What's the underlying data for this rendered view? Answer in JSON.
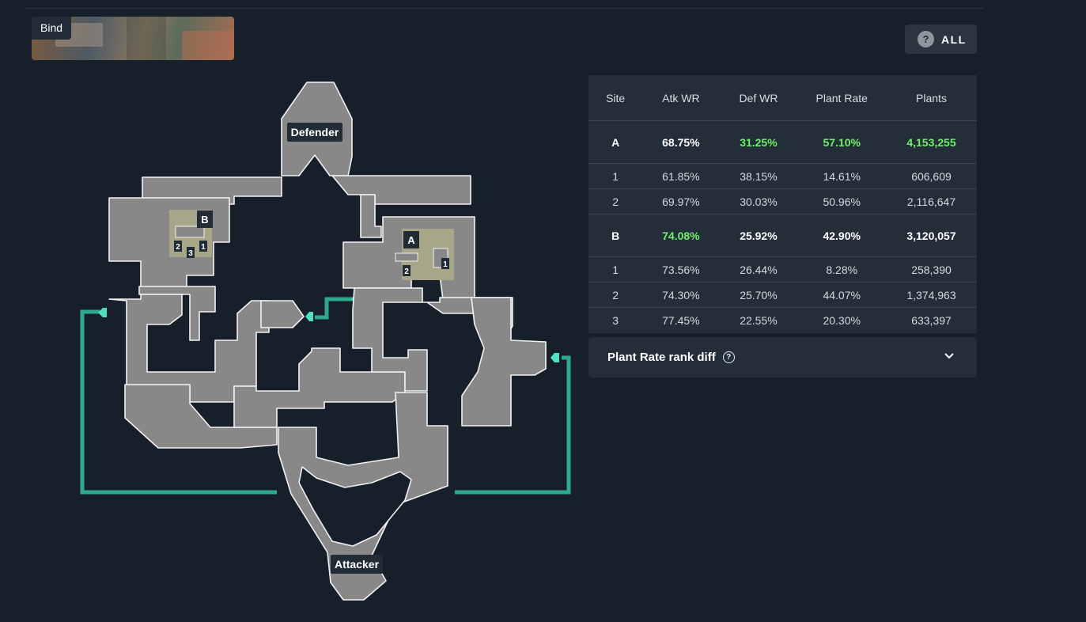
{
  "map": {
    "name": "Bind"
  },
  "filter": {
    "label": "ALL",
    "icon": "help-circle-icon"
  },
  "spawns": {
    "defender": "Defender",
    "attacker": "Attacker"
  },
  "site_labels": {
    "a": "A",
    "b": "B",
    "a_plants": [
      "1",
      "2"
    ],
    "b_plants": [
      "1",
      "2",
      "3"
    ]
  },
  "table": {
    "headers": [
      "Site",
      "Atk WR",
      "Def WR",
      "Plant Rate",
      "Plants"
    ],
    "rows": [
      {
        "type": "site",
        "site": "A",
        "atk_wr": "68.75%",
        "def_wr": "31.25%",
        "plant_rate": "57.10%",
        "plants": "4,153,255",
        "highlight": [
          "def_wr",
          "plant_rate",
          "plants"
        ]
      },
      {
        "type": "sub",
        "site": "1",
        "atk_wr": "61.85%",
        "def_wr": "38.15%",
        "plant_rate": "14.61%",
        "plants": "606,609"
      },
      {
        "type": "sub",
        "site": "2",
        "atk_wr": "69.97%",
        "def_wr": "30.03%",
        "plant_rate": "50.96%",
        "plants": "2,116,647"
      },
      {
        "type": "site",
        "site": "B",
        "atk_wr": "74.08%",
        "def_wr": "25.92%",
        "plant_rate": "42.90%",
        "plants": "3,120,057",
        "highlight": [
          "atk_wr"
        ]
      },
      {
        "type": "sub",
        "site": "1",
        "atk_wr": "73.56%",
        "def_wr": "26.44%",
        "plant_rate": "8.28%",
        "plants": "258,390"
      },
      {
        "type": "sub",
        "site": "2",
        "atk_wr": "74.30%",
        "def_wr": "25.70%",
        "plant_rate": "44.07%",
        "plants": "1,374,963"
      },
      {
        "type": "sub",
        "site": "3",
        "atk_wr": "77.45%",
        "def_wr": "22.55%",
        "plant_rate": "20.30%",
        "plants": "633,397"
      }
    ]
  },
  "accordion": {
    "title": "Plant Rate rank diff",
    "expanded": false
  },
  "colors": {
    "highlight": "#6ff06a",
    "teleporter": "#2fa98c",
    "floor": "#888888",
    "site_zone": "#a8a688"
  }
}
